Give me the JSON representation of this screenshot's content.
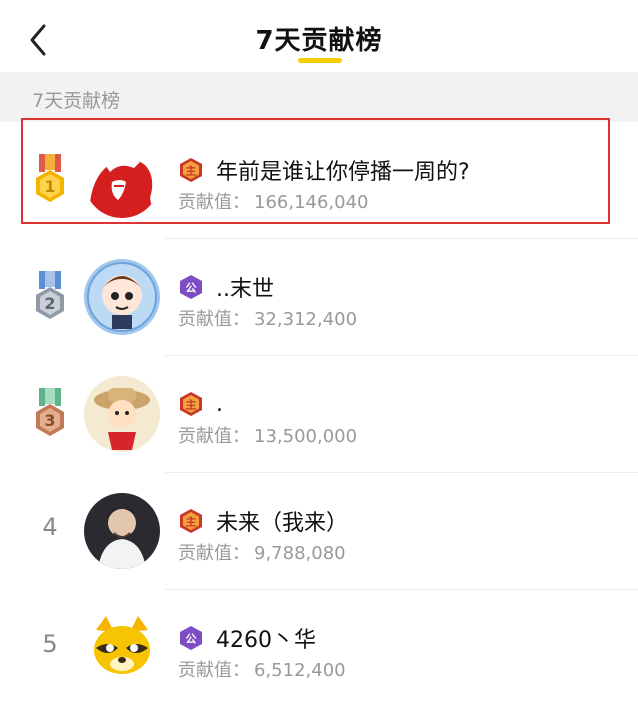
{
  "header": {
    "title": "7天贡献榜"
  },
  "section": {
    "label": "7天贡献榜"
  },
  "contrib_label": "贡献值：",
  "colors": {
    "accent": "#f6cd00",
    "highlight": "#d33",
    "host_badge": "#c9362a",
    "guild_badge": "#7d4dc6"
  },
  "entries": [
    {
      "rank": "1",
      "badge": "主",
      "name": "年前是谁让你停播一周的?",
      "value": "166,146,040"
    },
    {
      "rank": "2",
      "badge": "公",
      "name": "..末世",
      "value": "32,312,400"
    },
    {
      "rank": "3",
      "badge": "主",
      "name": ".",
      "value": "13,500,000"
    },
    {
      "rank": "4",
      "badge": "主",
      "name": "未来（我来）",
      "value": "9,788,080"
    },
    {
      "rank": "5",
      "badge": "公",
      "name": "4260丶华",
      "value": "6,512,400"
    }
  ]
}
